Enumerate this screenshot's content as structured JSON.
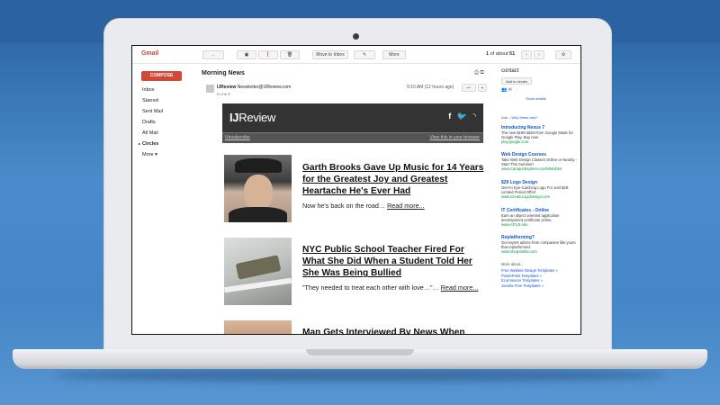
{
  "gmail": {
    "logo": "Gmail",
    "compose": "COMPOSE",
    "nav": [
      "Inbox",
      "Starred",
      "Sent Mail",
      "Drafts",
      "All Mail",
      "Circles",
      "More"
    ],
    "toolbar": {
      "back": "←",
      "archive": "▣",
      "spam": "❗",
      "delete": "🗑",
      "move_to_inbox": "Move to Inbox",
      "labels": "✎",
      "more": "More",
      "pager_pre": "1",
      "pager_mid": "of about",
      "pager_total": "51",
      "prev": "‹",
      "next": "›",
      "settings": "⚙"
    }
  },
  "message": {
    "subject": "Morning News",
    "print_icon": "⎙",
    "newwindow_icon": "⧉",
    "sender_name": "IJReview",
    "sender_email": "Newsletter@IJReview.com",
    "to": "to me",
    "time": "9:10 AM (12 hours ago)",
    "reply": "↩",
    "more": "▾"
  },
  "newsletter": {
    "logo_bold": "IJ",
    "logo_rest": "Review",
    "unsubscribe": "Unsubscribe",
    "view_in_browser": "View this in your browser",
    "stories": [
      {
        "title": "Garth Brooks Gave Up Music for 14 Years for the Greatest Joy and Greatest Heartache He's Ever Had",
        "teaser": "Now he's back on the road…",
        "read_more": "Read more..."
      },
      {
        "title": "NYC Public School Teacher Fired For What She Did When a Student Told Her She Was Being Bullied",
        "teaser": "\"They needed to treat each other with love…\"…",
        "read_more": "Read more..."
      },
      {
        "title": "Man Gets Interviewed By News When What's",
        "teaser": "",
        "read_more": ""
      }
    ]
  },
  "sidebar_right": {
    "contact": "contact",
    "add_to_circles": "Add to circles",
    "show_details": "Show details",
    "ads_label": "Ads –",
    "ads_why": "Why these ads?",
    "ads": [
      {
        "title": "Introducing Nexus 7",
        "body": "The new $199 tablet from Google Made for Google Play. Buy now",
        "url": "play.google.com"
      },
      {
        "title": "Web Design Courses",
        "body": "Take Web Design Classes Online or Nearby - Start This Summer!",
        "url": "www.CampusExplorer.com/WebDes"
      },
      {
        "title": "$29 Logo Design",
        "body": "Get An Eye-Catching Logo For Just $29. Limited Period Offer!",
        "url": "www.CreateLogoDesign.com"
      },
      {
        "title": "IT Certificates - Online",
        "body": "Earn an object oriented application development certificate online.",
        "url": "www.APUS.edu"
      },
      {
        "title": "Replatforming?",
        "body": "Get expert advice from companies like yours that replatformed.",
        "url": "www.shopvisible.com"
      }
    ],
    "more_about": "More about...",
    "more_links": [
      "Free Website Design Templates »",
      "PowerPoint Templates »",
      "Ecommerce Templates »",
      "Joomla Free Templates »"
    ]
  }
}
